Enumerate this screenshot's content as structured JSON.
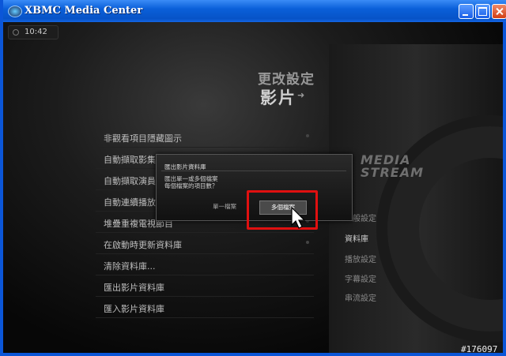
{
  "window": {
    "title": "XBMC Media Center"
  },
  "clock": {
    "time": "10:42"
  },
  "header": {
    "heading": "更改設定",
    "subheading": "影片"
  },
  "menu": {
    "items": [
      "非觀看項目隱藏圖示",
      "自動擷取影集的縮圖",
      "自動擷取演員的縮圖",
      "自動連續播放影片",
      "堆疊重複電視節目",
      "在啟動時更新資料庫",
      "清除資料庫...",
      "匯出影片資料庫",
      "匯入影片資料庫"
    ]
  },
  "media_panel": {
    "label_line1": "MEDIA",
    "label_line2": "STREAM",
    "items": [
      "一般設定",
      "資料庫",
      "播放設定",
      "字幕設定",
      "串流設定"
    ]
  },
  "dialog": {
    "title": "匯出影片資料庫",
    "message_line1": "匯出單一或多個檔案",
    "message_line2": "每個檔案的項目數？",
    "button_single": "單一檔案",
    "button_multi": "多個檔案"
  },
  "watermark": "#176097"
}
